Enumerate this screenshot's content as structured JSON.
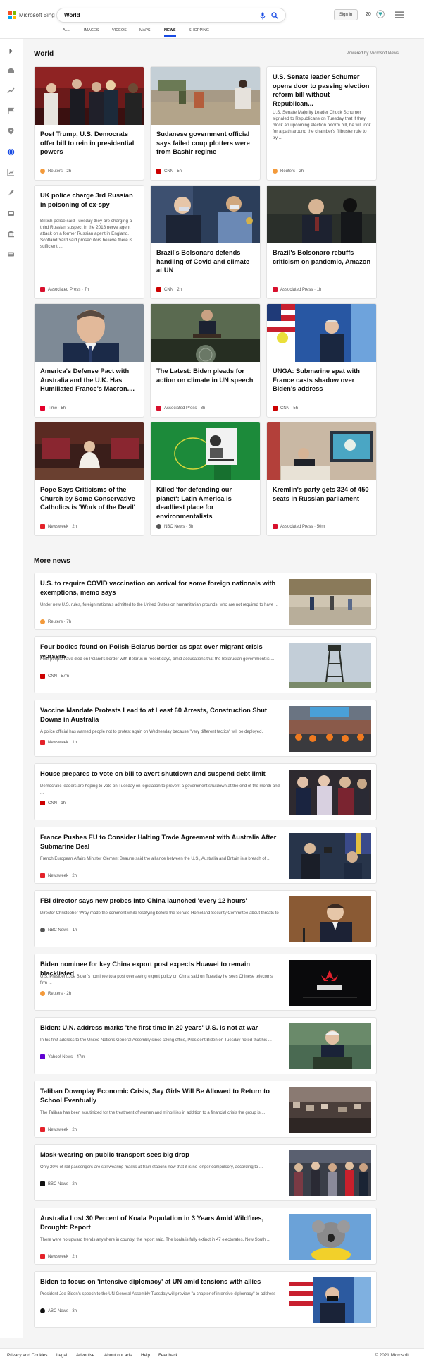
{
  "header": {
    "logo_text": "Microsoft Bing",
    "search_value": "World",
    "signin_label": "Sign in",
    "rewards_count": "20",
    "tabs": [
      "ALL",
      "IMAGES",
      "VIDEOS",
      "MAPS",
      "NEWS",
      "SHOPPING"
    ],
    "active_tab": "NEWS"
  },
  "section": {
    "title": "World",
    "powered_by": "Powered by Microsoft News"
  },
  "cards": [
    {
      "title": "Post Trump, U.S. Democrats offer bill to rein in presidential powers",
      "source": "Reuters",
      "time": "2h",
      "source_color": "#f39a3b"
    },
    {
      "title": "Sudanese government official says failed coup plotters were from Bashir regime",
      "source": "CNN",
      "time": "5h",
      "source_color": "#cc0000"
    },
    {
      "title": "U.S. Senate leader Schumer opens door to passing election reform bill without Republican...",
      "desc": "U.S. Senate Majority Leader Chuck Schumer signaled to Republicans on Tuesday that if they block an upcoming election reform bill, he will look for a path around the chamber's filibuster rule to try ...",
      "source": "Reuters",
      "time": "2h",
      "source_color": "#f39a3b",
      "text_only": true
    },
    {
      "title": "UK police charge 3rd Russian in poisoning of ex-spy",
      "desc": "British police said Tuesday they are charging a third Russian suspect in the 2018 nerve agent attack on a former Russian agent in England. Scotland Yard said prosecutors believe there is sufficient ...",
      "source": "Associated Press",
      "time": "7h",
      "source_color": "#d8102d",
      "text_only": true
    },
    {
      "title": "Brazil's Bolsonaro defends handling of Covid and climate at UN",
      "source": "CNN",
      "time": "2h",
      "source_color": "#cc0000"
    },
    {
      "title": "Brazil's Bolsonaro rebuffs criticism on pandemic, Amazon",
      "source": "Associated Press",
      "time": "1h",
      "source_color": "#d8102d"
    },
    {
      "title": "America's Defense Pact with Australia and the U.K. Has Humiliated France's Macron....",
      "source": "Time",
      "time": "5h",
      "source_color": "#e4002b"
    },
    {
      "title": "The Latest: Biden pleads for action on climate in UN speech",
      "source": "Associated Press",
      "time": "3h",
      "source_color": "#d8102d"
    },
    {
      "title": "UNGA: Submarine spat with France casts shadow over Biden's address",
      "source": "CNN",
      "time": "5h",
      "source_color": "#cc0000"
    },
    {
      "title": "Pope Says Criticisms of the Church by Some Conservative Catholics is 'Work of the Devil'",
      "source": "Newsweek",
      "time": "2h",
      "source_color": "#e4222a"
    },
    {
      "title": "Killed 'for defending our planet': Latin America is deadliest place for environmentalists",
      "source": "NBC News",
      "time": "5h",
      "source_color": "#555555"
    },
    {
      "title": "Kremlin's party gets 324 of 450 seats in Russian parliament",
      "source": "Associated Press",
      "time": "50m",
      "source_color": "#d8102d"
    }
  ],
  "more_news": {
    "title": "More news",
    "items": [
      {
        "title": "U.S. to require COVID vaccination on arrival for some foreign nationals with exemptions, memo says",
        "desc": "Under new U.S. rules, foreign nationals admitted to the United States on humanitarian grounds, who are not required to have ...",
        "source": "Reuters",
        "time": "7h",
        "source_color": "#f39a3b"
      },
      {
        "title": "Four bodies found on Polish-Belarus border as spat over migrant crisis worsens",
        "desc": "Four people have died on Poland's border with Belarus in recent days, amid accusations that the Belarusian government is ...",
        "source": "CNN",
        "time": "57m",
        "source_color": "#cc0000"
      },
      {
        "title": "Vaccine Mandate Protests Lead to at Least 60 Arrests, Construction Shut Downs in Australia",
        "desc": "A police official has warned people not to protest again on Wednesday because \"very different tactics\" will be deployed.",
        "source": "Newsweek",
        "time": "1h",
        "source_color": "#e4222a"
      },
      {
        "title": "House prepares to vote on bill to avert shutdown and suspend debt limit",
        "desc": "Democratic leaders are hoping to vote on Tuesday on legislation to prevent a government shutdown at the end of the month and ...",
        "source": "CNN",
        "time": "1h",
        "source_color": "#cc0000"
      },
      {
        "title": "France Pushes EU to Consider Halting Trade Agreement with Australia After Submarine Deal",
        "desc": "French European Affairs Minister Clement Beaune said the alliance between the U.S., Australia and Britain is a breach of ...",
        "source": "Newsweek",
        "time": "2h",
        "source_color": "#e4222a"
      },
      {
        "title": "FBI director says new probes into China launched 'every 12 hours'",
        "desc": "Director Christopher Wray made the comment while testifying before the Senate Homeland Security Committee about threats to ...",
        "source": "NBC News",
        "time": "1h",
        "source_color": "#555555"
      },
      {
        "title": "Biden nominee for key China export post expects Huawei to remain blacklisted",
        "desc": "U.S. President Joe Biden's nominee to a post overseeing export policy on China said on Tuesday he sees Chinese telecoms firm ...",
        "source": "Reuters",
        "time": "2h",
        "source_color": "#f39a3b"
      },
      {
        "title": "Biden: U.N. address marks 'the first time in 20 years' U.S. is not at war",
        "desc": "In his first address to the United Nations General Assembly since taking office, President Biden on Tuesday noted that his ...",
        "source": "Yahoo! News",
        "time": "47m",
        "source_color": "#6001d2"
      },
      {
        "title": "Taliban Downplay Economic Crisis, Say Girls Will Be Allowed to Return to School Eventually",
        "desc": "The Taliban has been scrutinized for the treatment of women and minorities in addition to a financial crisis the group is ...",
        "source": "Newsweek",
        "time": "2h",
        "source_color": "#e4222a"
      },
      {
        "title": "Mask-wearing on public transport sees big drop",
        "desc": "Only 20% of rail passengers are still wearing masks at train stations now that it is no longer compulsory, according to ...",
        "source": "BBC News",
        "time": "2h",
        "source_color": "#111111"
      },
      {
        "title": "Australia Lost 30 Percent of Koala Population in 3 Years Amid Wildfires, Drought: Report",
        "desc": "There were no upward trends anywhere in country, the report said. The koala is fully extinct in 47 electorates. New South ...",
        "source": "Newsweek",
        "time": "2h",
        "source_color": "#e4222a"
      },
      {
        "title": "Biden to focus on 'intensive diplomacy' at UN amid tensions with allies",
        "desc": "President Joe Biden's speech to the UN General Assembly Tuesday will preview \"a chapter of intensive diplomacy\" to address ...",
        "source": "ABC News",
        "time": "3h",
        "source_color": "#111111"
      }
    ]
  },
  "footer": {
    "links": [
      "Privacy and Cookies",
      "Legal",
      "Advertise",
      "About our ads",
      "Help",
      "Feedback"
    ],
    "copyright": "© 2021 Microsoft"
  },
  "colors": {
    "accent": "#174ae4",
    "bing_logo": [
      "#f25022",
      "#7fba00",
      "#00a4ef",
      "#ffb900"
    ]
  }
}
